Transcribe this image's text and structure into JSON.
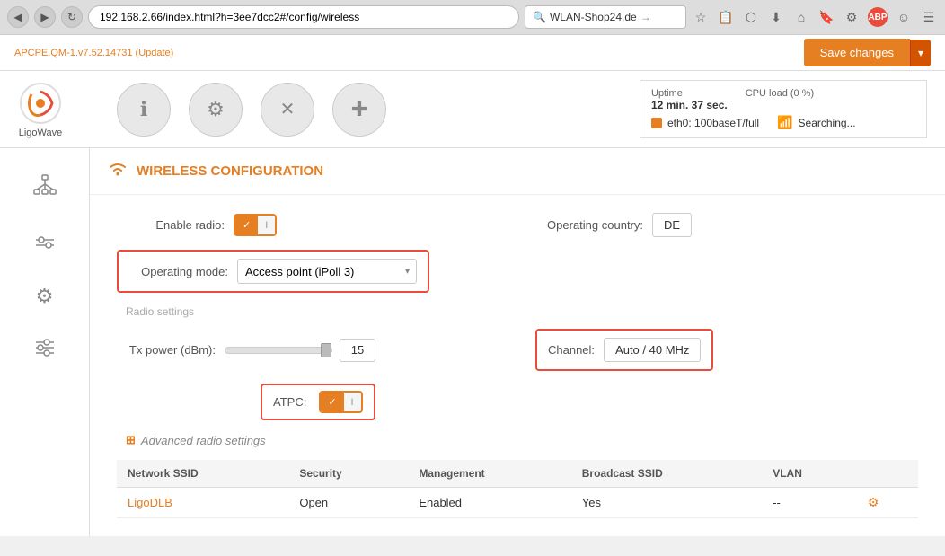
{
  "browser": {
    "url": "192.168.2.66/index.html?h=3ee7dcc2#/config/wireless",
    "search_placeholder": "WLAN-Shop24.de",
    "nav_back_icon": "◀",
    "nav_forward_icon": "▶",
    "refresh_icon": "↻",
    "menu_icon": "☰"
  },
  "app": {
    "version": "APCPE.QM-1.v7.52.14731",
    "update_label": "(Update)",
    "save_button_label": "Save changes",
    "dropdown_arrow": "▾"
  },
  "nav": {
    "logo_text": "LigoWave",
    "info_icon": "ℹ",
    "settings_icon": "⚙",
    "tools_icon": "✕",
    "plus_icon": "✚"
  },
  "status": {
    "uptime_label": "Uptime",
    "uptime_value": "12 min. 37 sec.",
    "cpu_label": "CPU load (0 %)",
    "eth_label": "eth0: 100baseT/full",
    "wifi_label": "Searching..."
  },
  "sidebar": {
    "items": [
      {
        "name": "network-icon",
        "icon": "⊞"
      },
      {
        "name": "equalizer-icon",
        "icon": "⇌"
      },
      {
        "name": "gear-icon",
        "icon": "⚙"
      },
      {
        "name": "sliders-icon",
        "icon": "≡"
      }
    ]
  },
  "wireless_config": {
    "section_title": "WIRELESS CONFIGURATION",
    "enable_radio_label": "Enable radio:",
    "toggle_on_label": "✓",
    "toggle_off_label": "I",
    "operating_country_label": "Operating country:",
    "operating_country_value": "DE",
    "operating_mode_label": "Operating mode:",
    "operating_mode_value": "Access point (iPoll 3)",
    "radio_settings_label": "Radio settings",
    "tx_power_label": "Tx power (dBm):",
    "tx_power_value": "15",
    "channel_label": "Channel:",
    "channel_value": "Auto / 40 MHz",
    "atpc_label": "ATPC:",
    "advanced_label": "Advanced radio settings",
    "table": {
      "headers": [
        "Network SSID",
        "Security",
        "Management",
        "Broadcast SSID",
        "VLAN"
      ],
      "rows": [
        {
          "ssid": "LigoDLB",
          "security": "Open",
          "management": "Enabled",
          "broadcast": "Yes",
          "vlan": "--"
        }
      ]
    }
  }
}
